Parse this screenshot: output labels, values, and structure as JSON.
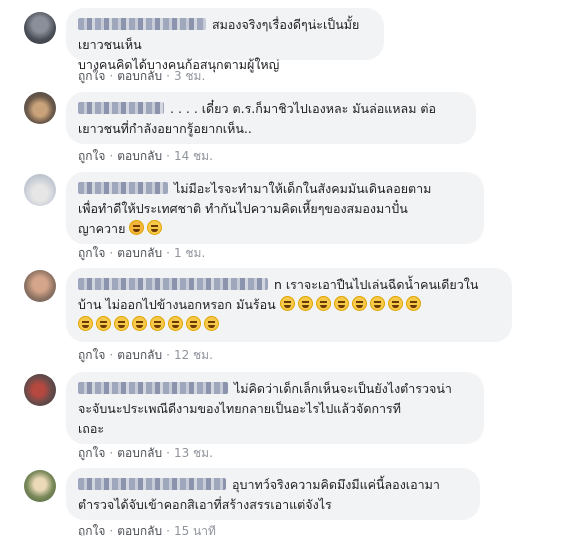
{
  "actions": {
    "like": "ถูกใจ",
    "reply": "ตอบกลับ",
    "dot": "·"
  },
  "comments": [
    {
      "text_line1": "สมองจริงๆเรื่องดีๆน่ะเป็นมั้ยเยาวชนเห็น",
      "text_line2": "บางคนคิดได้บางคนก้อสนุกตามผู้ใหญ่",
      "time": "3 ชม."
    },
    {
      "text_line1": ". . . . เดี๋ยว ต.ร.ก็มาชิวไปเองหละ มันล่อแหลม ต่อ",
      "text_line2": "เยาวชนที่กำลังอยากรู้อยากเห็น..",
      "time": "14 ชม."
    },
    {
      "text_line1": "ไม่มีอะไรจะทำมาให้เด็กในสังคมมันเดินลอยตาม",
      "text_line2": "เพื่อทำดีให้ประเทศชาติ ทำกันไปความคิดเหี้ยๆของสมองมาปั๋น",
      "text_line3": "ญาควาย",
      "time": "1 ชม."
    },
    {
      "text_line1": "n เราจะเอาปืนไปเล่นฉีดน้ำคนเดียวใน",
      "text_line2": "บ้าน ไม่ออกไปข้างนอกหรอก มันร้อน",
      "time": "12 ชม."
    },
    {
      "text_line1": "ไม่คิดว่าเด็กเล็กเห็นจะเป็นยังไงตำรวจน่า",
      "text_line2": "จะจับนะประเพณีดีงามของไทยกลายเป็นอะไรไปแล้วจัดการที",
      "text_line3": "เถอะ",
      "time": "13 ชม."
    },
    {
      "text_line1": "อุบาทว์จริงความคิดมึงมีแค่นี้ลองเอามา",
      "text_line2": "ตำรวจได้จับเข้าคอกสิเอาที่สร้างสรรเอาแต่จังไร",
      "time": "15 นาที"
    }
  ],
  "colors": {
    "bubble": "#f2f3f5",
    "action": "#606770",
    "emoji": "#f7c948"
  }
}
